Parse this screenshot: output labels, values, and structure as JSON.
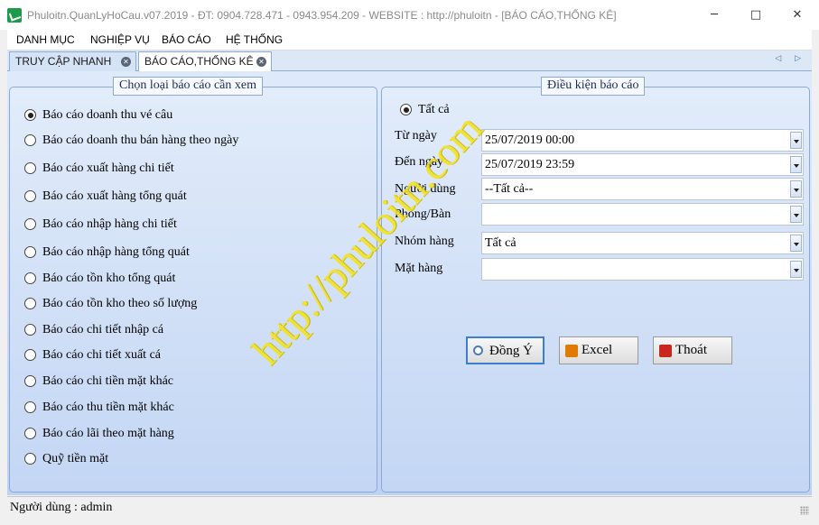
{
  "window": {
    "title": "Phuloitn.QuanLyHoCau.v07.2019 - ĐT: 0904.728.471 - 0943.954.209 - WEBSITE : http://phuloitn - [BÁO CÁO,THỐNG KÊ]",
    "controls": {
      "minimize": "─",
      "maximize": "□",
      "close": "✕"
    }
  },
  "menu": {
    "items": [
      "DANH MỤC",
      "NGHIỆP VỤ",
      "BÁO CÁO",
      "HỆ THỐNG"
    ]
  },
  "tabs": [
    {
      "label": "TRUY CẬP NHANH",
      "active": false
    },
    {
      "label": "BÁO CÁO,THỐNG KÊ",
      "active": true
    }
  ],
  "tab_nav": "◁ ▷",
  "report_types": {
    "legend": "Chọn loại báo cáo cần xem",
    "selected_index": 0,
    "items": [
      "Báo cáo doanh thu vé câu",
      "Báo cáo doanh thu bán hàng theo ngày",
      "Báo cáo xuất hàng chi tiết",
      "Báo cáo xuất hàng tổng quát",
      "Báo cáo nhập hàng chi tiết",
      "Báo cáo nhập hàng tổng quát",
      "Báo cáo tồn kho tổng quát",
      "Báo cáo tồn kho theo số lượng",
      "Báo cáo chi tiết nhập cá",
      "Báo cáo chi tiết xuất cá",
      "Báo cáo chi tiền mặt khác",
      "Báo cáo thu tiền mặt khác",
      "Báo cáo lãi theo mặt hàng",
      "Quỹ tiền mặt"
    ]
  },
  "conditions": {
    "legend": "Điều kiện báo cáo",
    "all_option": "Tất cả",
    "all_checked": true,
    "fields": [
      {
        "label": "Từ ngày",
        "value": "25/07/2019 00:00"
      },
      {
        "label": "Đến ngày",
        "value": "25/07/2019 23:59"
      },
      {
        "label": "Người dùng",
        "value": "--Tất cả--"
      },
      {
        "label": "Phòng/Bàn",
        "value": ""
      },
      {
        "label": "Nhóm hàng",
        "value": "Tất cả"
      },
      {
        "label": "Mặt hàng",
        "value": ""
      }
    ],
    "buttons": {
      "ok": "Đồng Ý",
      "excel": "Excel",
      "exit": "Thoát"
    }
  },
  "watermark": "http://phuloitn.com",
  "status": {
    "text": "Người dùng : admin"
  },
  "colors": {
    "tab_border": "#8eaed8",
    "panel_border": "#8ca9d6",
    "watermark": "#f2e323",
    "focus_border": "#3c7fd1"
  }
}
